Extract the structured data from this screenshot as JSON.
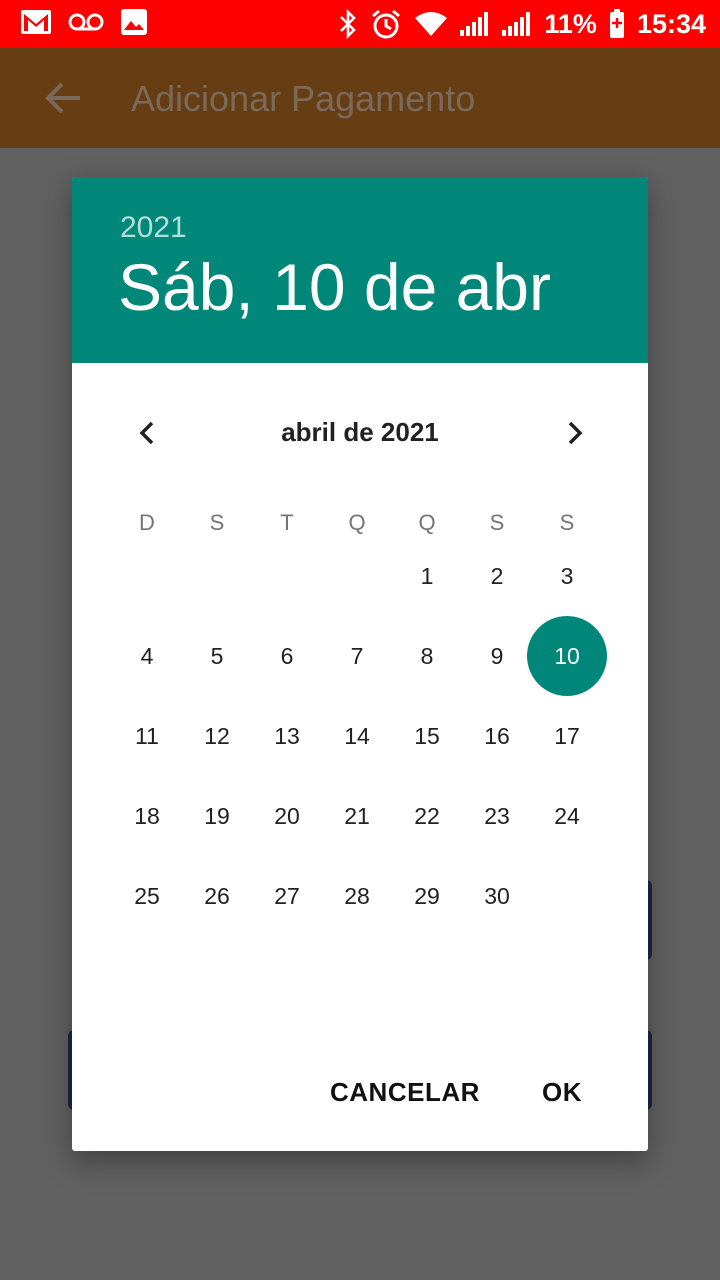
{
  "status_bar": {
    "battery": "11%",
    "time": "15:34"
  },
  "app_bar": {
    "title": "Adicionar Pagamento"
  },
  "dialog": {
    "year": "2021",
    "selected_date": "Sáb, 10 de abr",
    "month_title": "abril de 2021",
    "weekdays": [
      "D",
      "S",
      "T",
      "Q",
      "Q",
      "S",
      "S"
    ],
    "first_weekday_index": 4,
    "days_in_month": 30,
    "selected_day": "10",
    "cancel_label": "CANCELAR",
    "ok_label": "OK"
  },
  "colors": {
    "status_bar": "#ff0000",
    "app_bar": "#673d13",
    "accent": "#00877a",
    "scrim": "#616161"
  }
}
